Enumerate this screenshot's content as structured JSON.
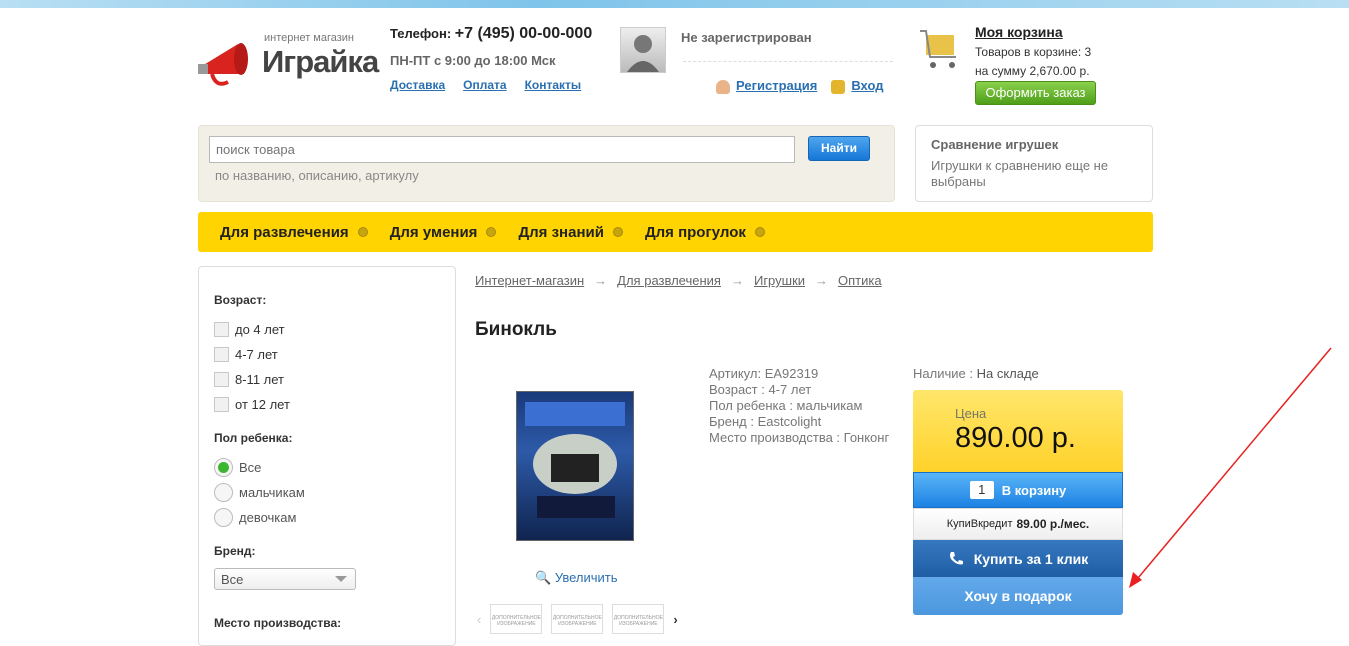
{
  "header": {
    "logo_sub": "интернет магазин",
    "logo_name": "Играйка",
    "phone_label": "Телефон:",
    "phone_number": "+7 (495) 00-00-000",
    "hours": "ПН-ПТ с 9:00 до 18:00 Мск",
    "links": [
      "Доставка",
      "Оплата",
      "Контакты"
    ],
    "user_status": "Не зарегистрирован",
    "register": "Регистрация",
    "login": "Вход",
    "cart_title": "Моя корзина",
    "cart_count": "Товаров в корзине: 3",
    "cart_sum": "на сумму 2,670.00 р.",
    "order_button": "Оформить заказ"
  },
  "search": {
    "placeholder": "поиск товара",
    "button": "Найти",
    "hint": "по названию, описанию, артикулу"
  },
  "compare": {
    "title": "Сравнение игрушек",
    "text": "Игрушки к сравнению еще не выбраны"
  },
  "nav": [
    "Для развлечения",
    "Для умения",
    "Для знаний",
    "Для прогулок"
  ],
  "sidebar": {
    "age_label": "Возраст:",
    "ages": [
      "до 4 лет",
      "4-7 лет",
      "8-11 лет",
      "от 12 лет"
    ],
    "gender_label": "Пол ребенка:",
    "genders": [
      "Все",
      "мальчикам",
      "девочкам"
    ],
    "brand_label": "Бренд:",
    "brand_value": "Все",
    "origin_label": "Место производства:"
  },
  "breadcrumb": [
    "Интернет-магазин",
    "Для развлечения",
    "Игрушки",
    "Оптика"
  ],
  "product": {
    "title": "Бинокль",
    "zoom": "Увеличить",
    "thumb_text": "ДОПОЛНИТЕЛЬНОЕ ИЗОБРАЖЕНИЕ",
    "props": [
      "Артикул: EA92319",
      "Возраст : 4-7 лет",
      "Пол ребенка : мальчикам",
      "Бренд : Eastcolight",
      "Место производства : Гонконг"
    ],
    "avail_label": "Наличие :",
    "avail_value": "На складе",
    "price_label": "Цена",
    "price": "890.00 р.",
    "qty": "1",
    "to_cart": "В корзину",
    "credit_label": "КупиВкредит",
    "credit_value": "89.00 р./мес.",
    "buy_one_click": "Купить за 1 клик",
    "gift": "Хочу в подарок"
  },
  "colors": {
    "accent_yellow": "#ffd400",
    "accent_blue": "#1d82e4",
    "annotation_red": "#e8201f"
  }
}
